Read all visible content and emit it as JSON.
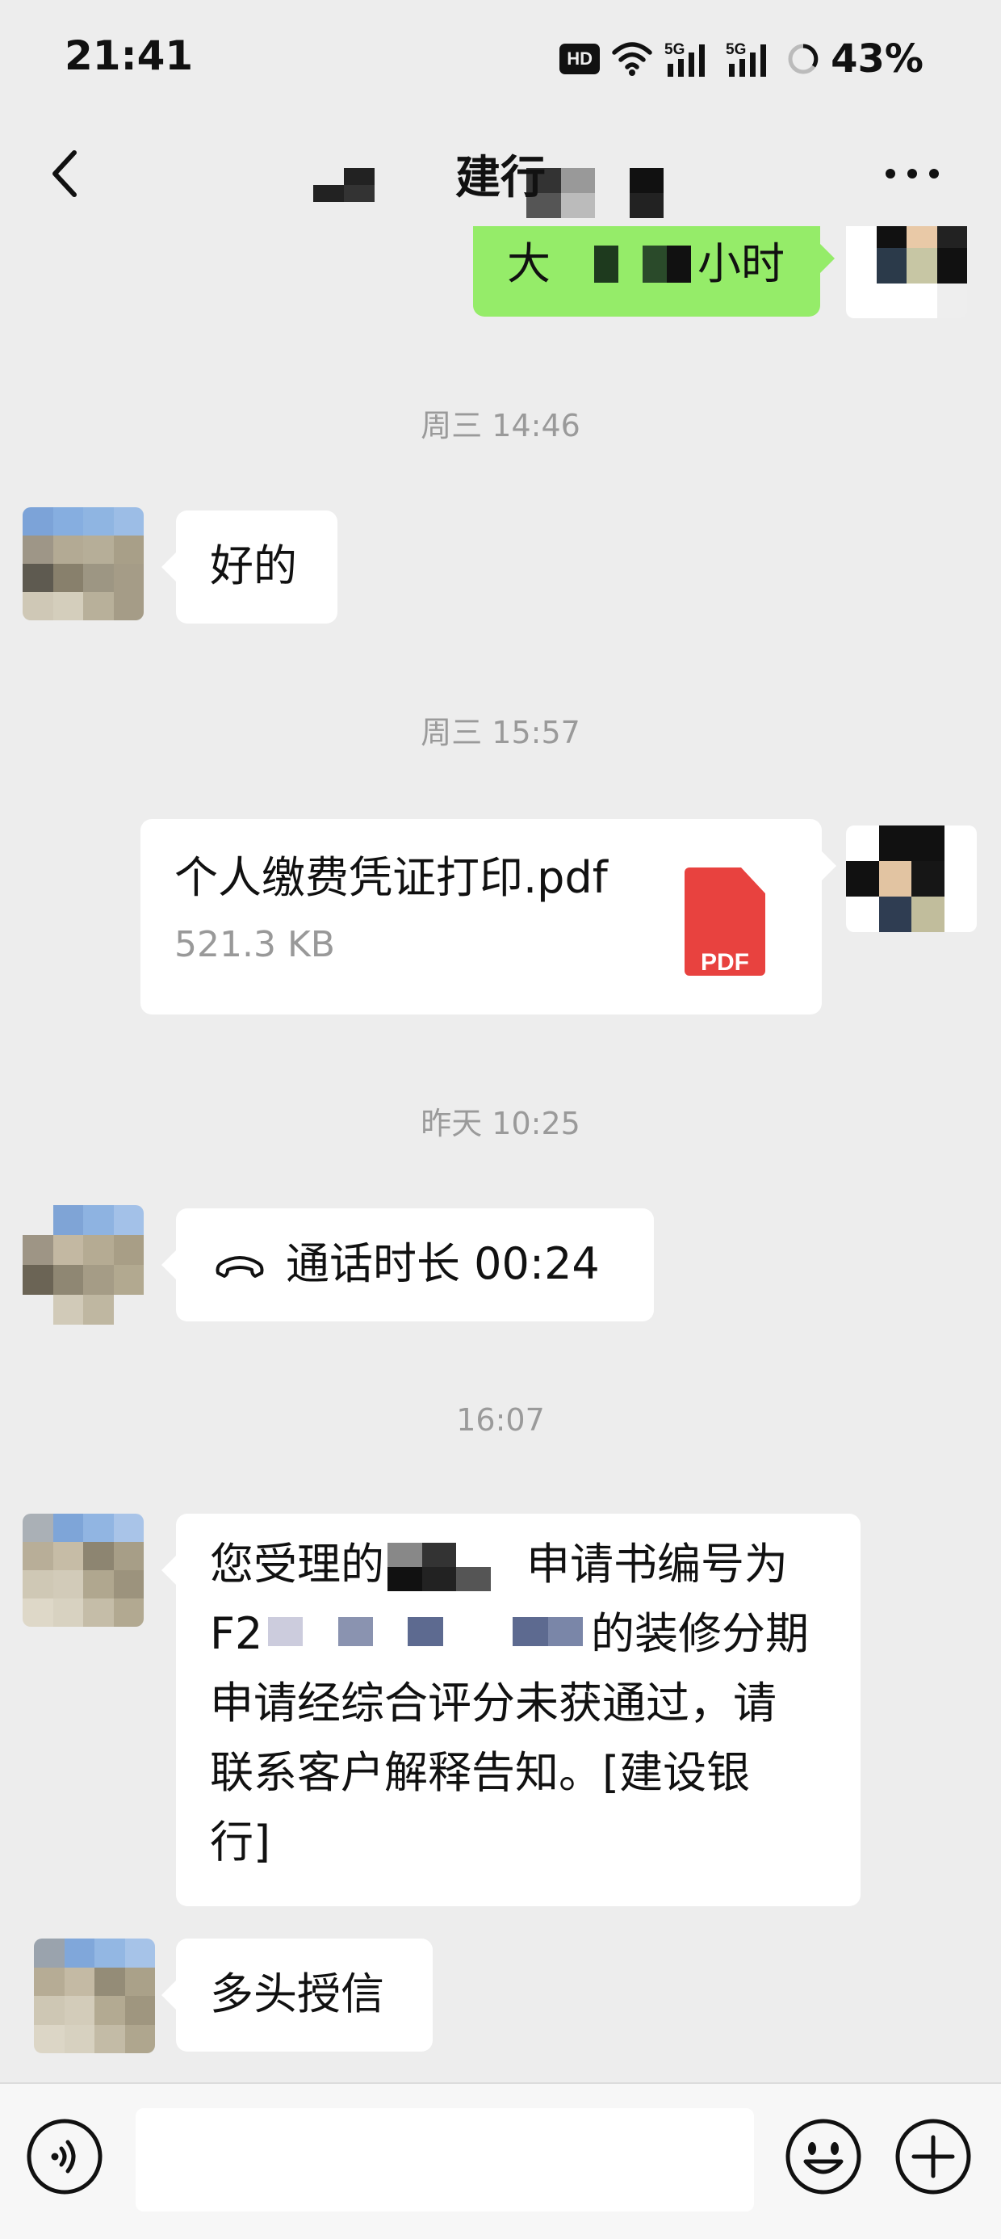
{
  "status_bar": {
    "time": "21:41",
    "hd_label": "HD",
    "net1": "5G",
    "net2": "5G",
    "battery": "43%"
  },
  "nav": {
    "title": "建行",
    "back_icon": "chevron-left-icon",
    "more_icon": "more-dots-icon"
  },
  "messages": [
    {
      "side": "right",
      "type": "text",
      "text_prefix": "大",
      "text_suffix": "小时"
    },
    {
      "type": "time",
      "text": "周三 14:46"
    },
    {
      "side": "left",
      "type": "text",
      "text": "好的"
    },
    {
      "type": "time",
      "text": "周三 15:57"
    },
    {
      "side": "right",
      "type": "file",
      "file_name": "个人缴费凭证打印.pdf",
      "file_size": "521.3 KB",
      "file_icon_label": "PDF"
    },
    {
      "type": "time",
      "text": "昨天 10:25"
    },
    {
      "side": "left",
      "type": "call",
      "text": "通话时长 00:24"
    },
    {
      "type": "time",
      "text": "16:07"
    },
    {
      "side": "left",
      "type": "text",
      "line1_a": "您受理的",
      "line1_b": "申请书编号为",
      "line2_a": "F2",
      "line2_b": "的装修分期",
      "line3": "申请经综合评分未获通过，请",
      "line4": "联系客户解释告知。[建设银",
      "line5": "行]"
    },
    {
      "side": "left",
      "type": "text",
      "text": "多头授信"
    }
  ],
  "input_bar": {
    "placeholder": "",
    "voice_icon": "voice-icon",
    "emoji_icon": "emoji-icon",
    "plus_icon": "plus-icon"
  }
}
